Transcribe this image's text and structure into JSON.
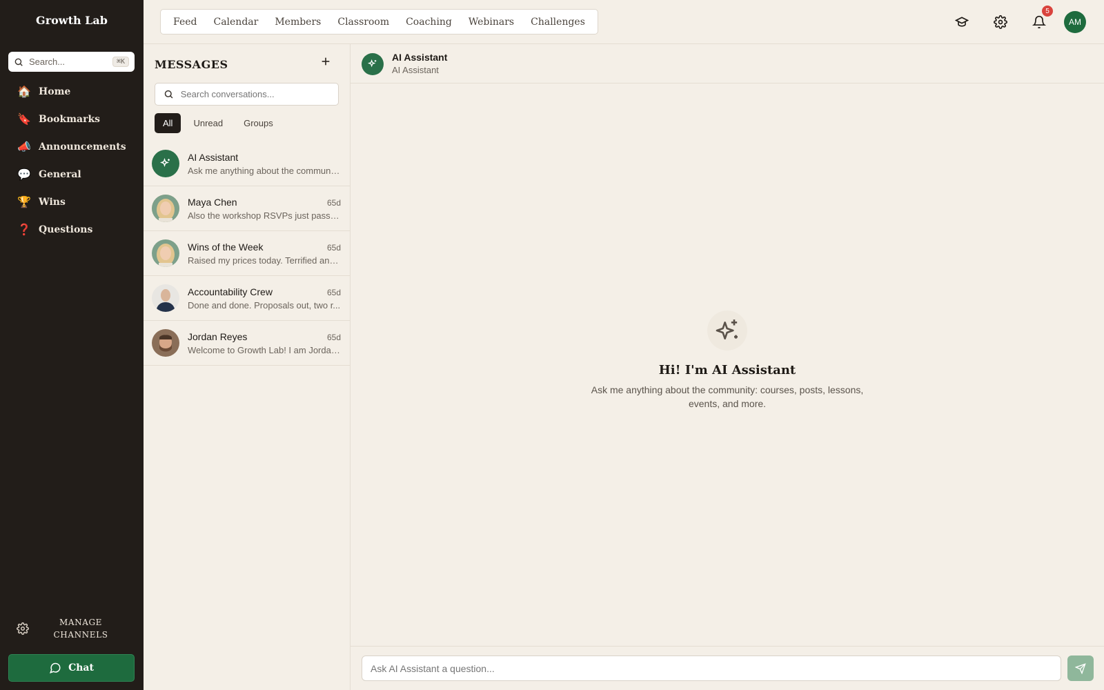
{
  "app": {
    "brand": "Growth Lab"
  },
  "sidebar": {
    "search_placeholder": "Search...",
    "search_shortcut": "⌘K",
    "items": [
      {
        "emoji": "🏠",
        "label": "Home",
        "icon": "home-icon"
      },
      {
        "emoji": "🔖",
        "label": "Bookmarks",
        "icon": "bookmark-icon"
      },
      {
        "emoji": "📣",
        "label": "Announcements",
        "icon": "megaphone-icon"
      },
      {
        "emoji": "💬",
        "label": "General",
        "icon": "speech-bubble-icon"
      },
      {
        "emoji": "🏆",
        "label": "Wins",
        "icon": "trophy-icon"
      },
      {
        "emoji": "❓",
        "label": "Questions",
        "icon": "question-icon"
      }
    ],
    "manage_label": "MANAGE CHANNELS",
    "chat_label": "Chat"
  },
  "topnav": {
    "tabs": [
      "Feed",
      "Calendar",
      "Members",
      "Classroom",
      "Coaching",
      "Webinars",
      "Challenges"
    ],
    "notifications_count": "5",
    "user_initials": "AM"
  },
  "messages": {
    "title": "MESSAGES",
    "search_placeholder": "Search conversations...",
    "filters": [
      "All",
      "Unread",
      "Groups"
    ],
    "active_filter": "All",
    "conversations": [
      {
        "name": "AI Assistant",
        "time": "",
        "snippet": "Ask me anything about the community...",
        "avatar": "ai"
      },
      {
        "name": "Maya Chen",
        "time": "65d",
        "snippet": "Also the workshop RSVPs just passed...",
        "avatar": "photo"
      },
      {
        "name": "Wins of the Week",
        "time": "65d",
        "snippet": "Raised my prices today. Terrified and...",
        "avatar": "photo"
      },
      {
        "name": "Accountability Crew",
        "time": "65d",
        "snippet": "Done and done. Proposals out, two r...",
        "avatar": "photo"
      },
      {
        "name": "Jordan Reyes",
        "time": "65d",
        "snippet": "Welcome to Growth Lab! I am Jordan...",
        "avatar": "photo"
      }
    ]
  },
  "chat": {
    "title": "AI Assistant",
    "subtitle": "AI Assistant",
    "welcome_title": "Hi! I'm AI Assistant",
    "welcome_text": "Ask me anything about the community: courses, posts, lessons, events, and more.",
    "input_placeholder": "Ask AI Assistant a question..."
  },
  "colors": {
    "sidebar": "#221d19",
    "accent": "#1e6b3e",
    "background": "#f4efe7"
  }
}
